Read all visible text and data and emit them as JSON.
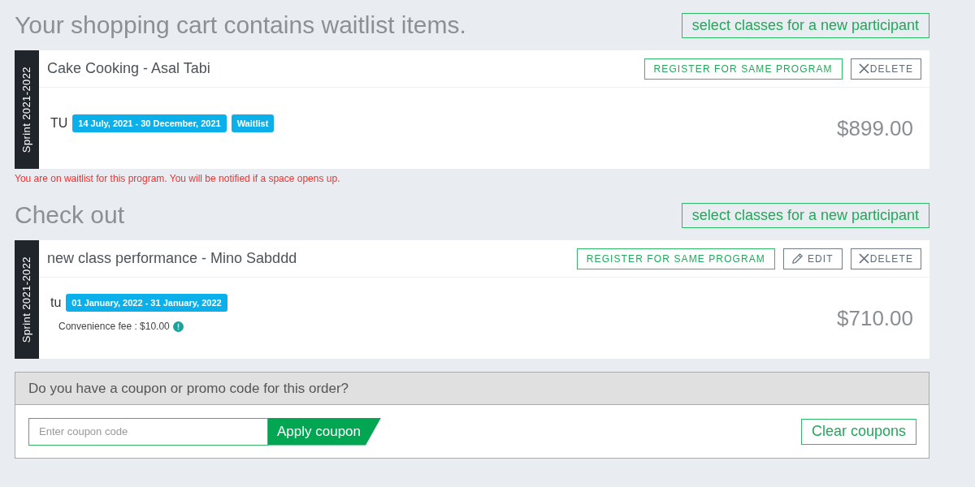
{
  "sections": [
    {
      "heading": "Your shopping cart contains waitlist items.",
      "new_participant_button": "select classes for a new participant",
      "items": [
        {
          "season": "Sprint 2021-2022",
          "title": "Cake Cooking - Asal Tabi",
          "buttons": [
            {
              "kind": "register",
              "label": "REGISTER FOR SAME PROGRAM"
            },
            {
              "kind": "delete",
              "label": "DELETE"
            }
          ],
          "day": "TU",
          "badges": [
            "14 July, 2021 - 30 December, 2021",
            "Waitlist"
          ],
          "price": "$899.00"
        }
      ],
      "notice": "You are on waitlist for this program. You will be notified if a space opens up."
    },
    {
      "heading": "Check out",
      "new_participant_button": "select classes for a new participant",
      "items": [
        {
          "season": "Sprint 2021-2022",
          "title": "new class performance - Mino Sabddd",
          "buttons": [
            {
              "kind": "register",
              "label": "REGISTER FOR SAME PROGRAM"
            },
            {
              "kind": "edit",
              "label": "EDIT"
            },
            {
              "kind": "delete",
              "label": "DELETE"
            }
          ],
          "day": "tu",
          "badges": [
            "01 January, 2022 - 31 January, 2022"
          ],
          "fee": "Convenience fee : $10.00",
          "price": "$710.00"
        }
      ]
    }
  ],
  "coupon": {
    "question": "Do you have a coupon or promo code for this order?",
    "placeholder": "Enter coupon code",
    "apply_button": "Apply coupon",
    "clear_button": "Clear coupons"
  }
}
